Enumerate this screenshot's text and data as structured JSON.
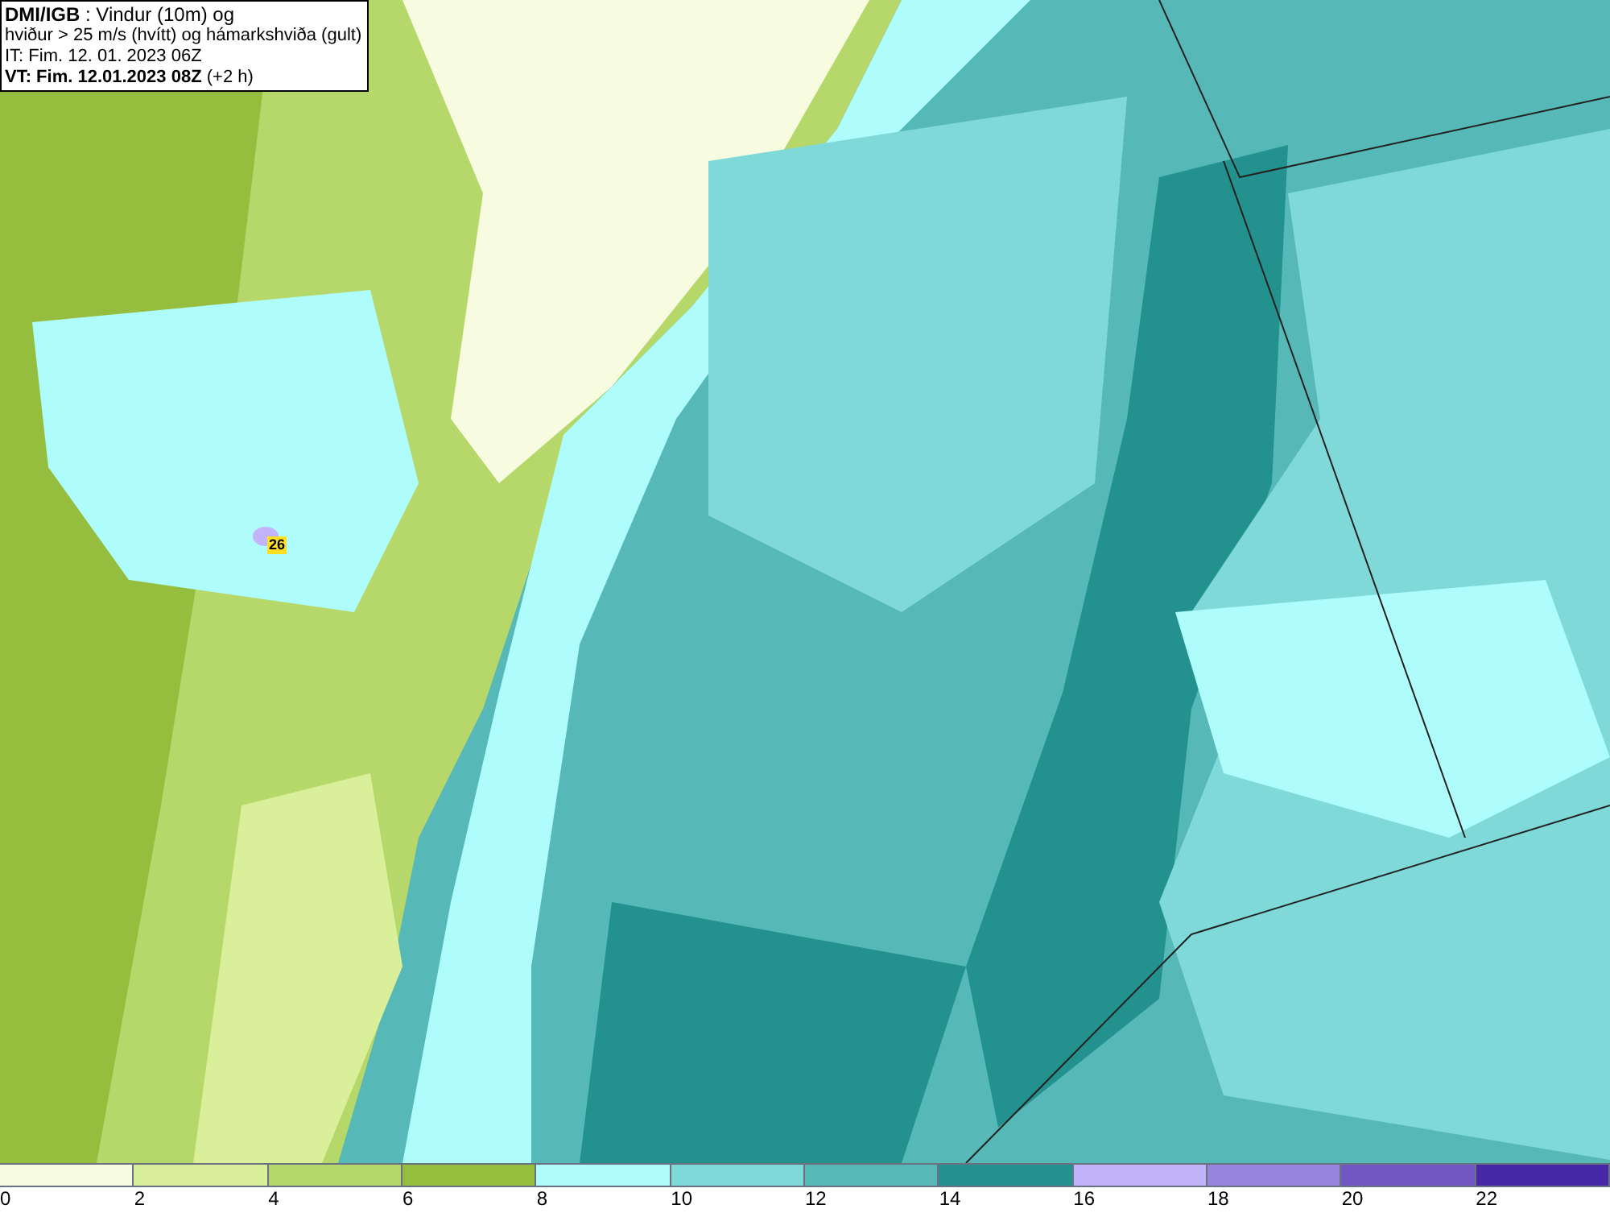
{
  "title_box": {
    "lines": [
      "**DMI/IGB** : Vindur (10m) og",
      "hviður > 25 m/s (hvítt) og hámarkshviða (gult)",
      "IT: Fim. 12. 01. 2023 06Z",
      "**VT: Fim. 12.01.2023 08Z** (+2 h)"
    ]
  },
  "map": {
    "max_gust_label": "26"
  },
  "legend": {
    "items": [
      {
        "label": "0",
        "color": "#f7fbe0"
      },
      {
        "label": "2",
        "color": "#d9ef9a"
      },
      {
        "label": "4",
        "color": "#b6d86a"
      },
      {
        "label": "6",
        "color": "#96be3e"
      },
      {
        "label": "8",
        "color": "#aefcfc"
      },
      {
        "label": "10",
        "color": "#7fd9d9"
      },
      {
        "label": "12",
        "color": "#57b8b8"
      },
      {
        "label": "14",
        "color": "#23928e"
      },
      {
        "label": "16",
        "color": "#c2b4fa"
      },
      {
        "label": "18",
        "color": "#9685de"
      },
      {
        "label": "20",
        "color": "#7256c2"
      },
      {
        "label": "22",
        "color": "#4528a6"
      }
    ]
  }
}
